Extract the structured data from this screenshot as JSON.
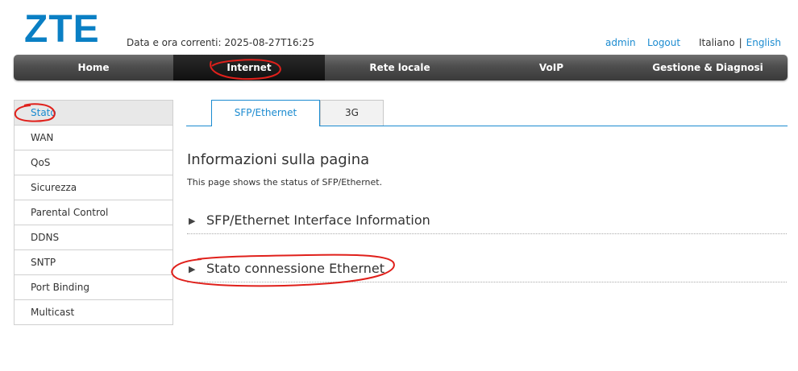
{
  "header": {
    "logo": "ZTE",
    "datetime_label": "Data e ora correnti:",
    "datetime_value": "2025-08-27T16:25",
    "user": "admin",
    "logout": "Logout",
    "lang_current": "Italiano",
    "lang_separator": "|",
    "lang_other": "English"
  },
  "nav": {
    "items": [
      "Home",
      "Internet",
      "Rete locale",
      "VoIP",
      "Gestione & Diagnosi"
    ],
    "active": "Internet"
  },
  "sidebar": {
    "items": [
      "Stato",
      "WAN",
      "QoS",
      "Sicurezza",
      "Parental Control",
      "DDNS",
      "SNTP",
      "Port Binding",
      "Multicast"
    ],
    "active": "Stato"
  },
  "tabs": {
    "items": [
      "SFP/Ethernet",
      "3G"
    ],
    "active": "SFP/Ethernet"
  },
  "page": {
    "title": "Informazioni sulla pagina",
    "description": "This page shows the status of SFP/Ethernet."
  },
  "sections": [
    {
      "title": "SFP/Ethernet Interface Information",
      "icon": "triangle-right-icon"
    },
    {
      "title": "Stato connessione Ethernet",
      "icon": "triangle-right-icon"
    }
  ],
  "colors": {
    "brand": "#0a7fc4",
    "link": "#1b8bd0",
    "annotation": "#e0201b"
  }
}
